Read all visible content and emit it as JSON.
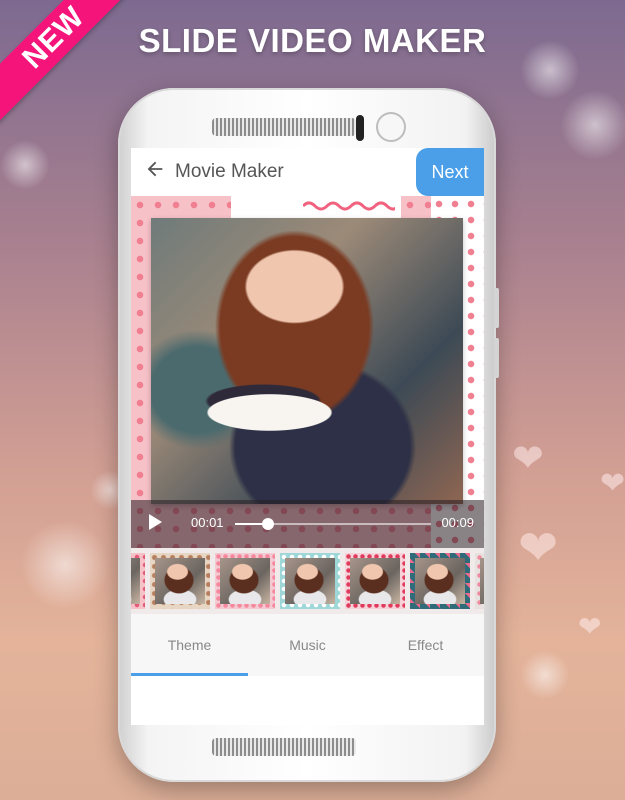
{
  "promo": {
    "ribbon_text": "NEW",
    "headline": "SLIDE VIDEO MAKER"
  },
  "app": {
    "title": "Movie Maker",
    "next_label": "Next"
  },
  "player": {
    "current_time": "00:01",
    "total_time": "00:09",
    "progress": 0.17
  },
  "tabs": [
    {
      "label": "Theme",
      "selected": true
    },
    {
      "label": "Music",
      "selected": false
    },
    {
      "label": "Effect",
      "selected": false
    }
  ],
  "thumbnails": [
    {
      "frame": "dots-pink"
    },
    {
      "frame": "floral"
    },
    {
      "frame": "hearts"
    },
    {
      "frame": "teal-dots"
    },
    {
      "frame": "pink-dots"
    },
    {
      "frame": "diamond"
    },
    {
      "frame": "lace"
    }
  ],
  "colors": {
    "accent": "#4a9fe8",
    "ribbon": "#f5157a"
  }
}
